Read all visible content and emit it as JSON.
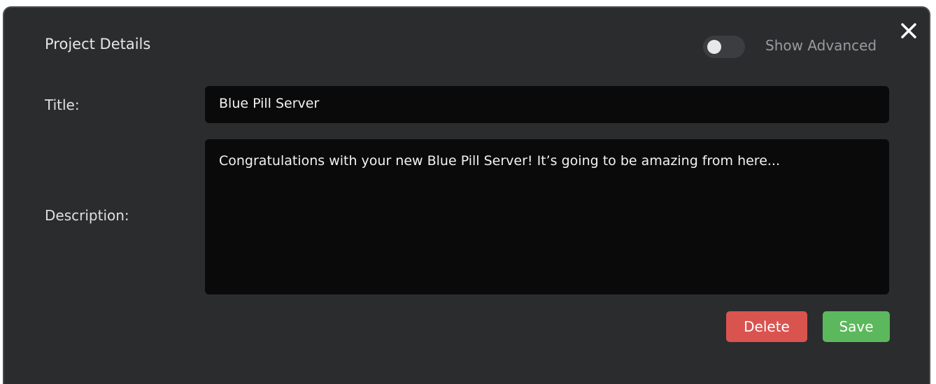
{
  "dialog": {
    "title": "Project Details",
    "show_advanced_label": "Show Advanced",
    "show_advanced_on": false,
    "close_icon": "close-icon"
  },
  "form": {
    "title_label": "Title:",
    "title_value": "Blue Pill Server",
    "description_label": "Description:",
    "description_value": "Congratulations with your new Blue Pill Server! It’s going to be amazing from here..."
  },
  "actions": {
    "delete_label": "Delete",
    "save_label": "Save"
  },
  "colors": {
    "background": "#2b2c2e",
    "input_background": "#0a0a0b",
    "delete": "#d9534f",
    "save": "#5cb85c"
  }
}
